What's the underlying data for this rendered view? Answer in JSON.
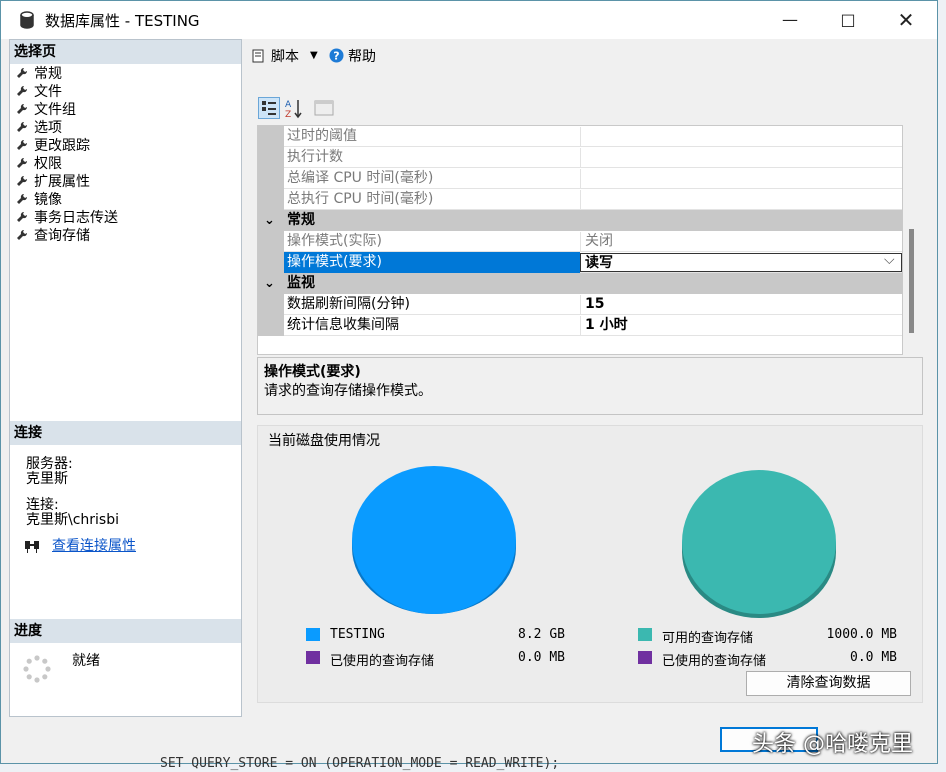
{
  "window": {
    "title": "数据库属性 - TESTING"
  },
  "left": {
    "select_page_header": "选择页",
    "nav_items": [
      "常规",
      "文件",
      "文件组",
      "选项",
      "更改跟踪",
      "权限",
      "扩展属性",
      "镜像",
      "事务日志传送",
      "查询存储"
    ],
    "connection_header": "连接",
    "server_label": "服务器:",
    "server_value": "克里斯",
    "connection_label": "连接:",
    "connection_value": "克里斯\\chrisbi",
    "view_connection_link": "查看连接属性",
    "progress_header": "进度",
    "progress_status": "就绪"
  },
  "toolbar": {
    "script_label": "脚本",
    "help_label": "帮助"
  },
  "grid": {
    "rows_top": [
      {
        "name": "过时的阈值",
        "value": ""
      },
      {
        "name": "执行计数",
        "value": ""
      },
      {
        "name": "总编译 CPU 时间(毫秒)",
        "value": ""
      },
      {
        "name": "总执行 CPU 时间(毫秒)",
        "value": ""
      }
    ],
    "cat_general": "常规",
    "general_rows": [
      {
        "name": "操作模式(实际)",
        "value": "关闭"
      },
      {
        "name": "操作模式(要求)",
        "value": "读写"
      }
    ],
    "cat_monitor": "监视",
    "monitor_rows": [
      {
        "name": "数据刷新间隔(分钟)",
        "value": "15"
      },
      {
        "name": "统计信息收集间隔",
        "value": "1 小时"
      }
    ]
  },
  "description": {
    "title": "操作模式(要求)",
    "text": "请求的查询存储操作模式。"
  },
  "disk": {
    "header": "当前磁盘使用情况",
    "left_pie": {
      "color": "#0a9bff",
      "legend": [
        {
          "label": "TESTING",
          "value": "8.2 GB",
          "color": "#0a9bff"
        },
        {
          "label": "已使用的查询存储",
          "value": "0.0 MB",
          "color": "#7030a0"
        }
      ]
    },
    "right_pie": {
      "color": "#3bb8b0",
      "legend": [
        {
          "label": "可用的查询存储",
          "value": "1000.0 MB",
          "color": "#3bb8b0"
        },
        {
          "label": "已使用的查询存储",
          "value": "0.0 MB",
          "color": "#7030a0"
        }
      ]
    },
    "clear_button": "清除查询数据"
  },
  "watermark": "头条 @哈喽克里",
  "background_code": "SET QUERY_STORE = ON (OPERATION_MODE = READ_WRITE);"
}
